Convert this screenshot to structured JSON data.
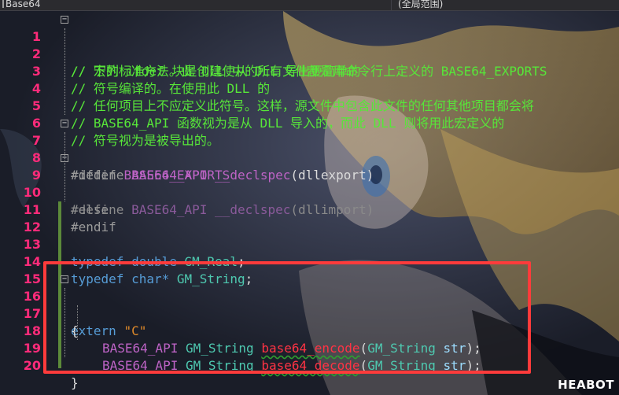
{
  "dropdowns": {
    "file_scope": "Base64",
    "symbol_scope": "(全局范围)"
  },
  "lines": [
    {
      "n": "1",
      "text": "// 下列 ifdef 块是创建使从 DLL 导出更简单的"
    },
    {
      "n": "2",
      "text": "// 宏的标准方法。此 DLL 中的所有文件都是用命令行上定义的 BASE64_EXPORTS"
    },
    {
      "n": "3",
      "text": "// 符号编译的。在使用此 DLL 的"
    },
    {
      "n": "4",
      "text": "// 任何项目上不应定义此符号。这样，源文件中包含此文件的任何其他项目都会将"
    },
    {
      "n": "5",
      "text": "// BASE64_API 函数视为是从 DLL 导入的，而此 DLL 则将用此宏定义的"
    },
    {
      "n": "6",
      "text": "// 符号视为是被导出的。"
    },
    {
      "n": "7",
      "pre": "#ifdef",
      "macro": "BASE64_EXPORTS"
    },
    {
      "n": "8",
      "pre": "#define",
      "macro": "BASE64_API",
      "kw": "__declspec",
      "arg": "(dllexport)"
    },
    {
      "n": "9",
      "pre": "#else"
    },
    {
      "n": "10",
      "pre": "#define",
      "macro": "BASE64_API",
      "kw": "__declspec",
      "arg": "(dllimport)"
    },
    {
      "n": "11",
      "pre": "#endif"
    },
    {
      "n": "12"
    },
    {
      "n": "13",
      "kw1": "typedef",
      "kw2": "double",
      "type": "GM_Real",
      "end": ";"
    },
    {
      "n": "14",
      "kw1": "typedef",
      "kw2": "char*",
      "type": "GM_String",
      "end": ";"
    },
    {
      "n": "15"
    },
    {
      "n": "16",
      "kw1": "extern",
      "str": "\"C\""
    },
    {
      "n": "17",
      "brace": "{"
    },
    {
      "n": "18",
      "macro": "BASE64_API",
      "type": "GM_String",
      "func": "base64_encode",
      "ptype": "GM_String",
      "param": "str",
      "end": ");"
    },
    {
      "n": "19",
      "macro": "BASE64_API",
      "type": "GM_String",
      "func": "base64_decode",
      "ptype": "GM_String",
      "param": "str",
      "end": ");"
    },
    {
      "n": "20",
      "brace": "}"
    }
  ],
  "watermark": "HEABOT",
  "colors": {
    "line_numbers": "#ff2b7a",
    "comment": "#57e639",
    "highlight_box": "#ff3b3b"
  }
}
